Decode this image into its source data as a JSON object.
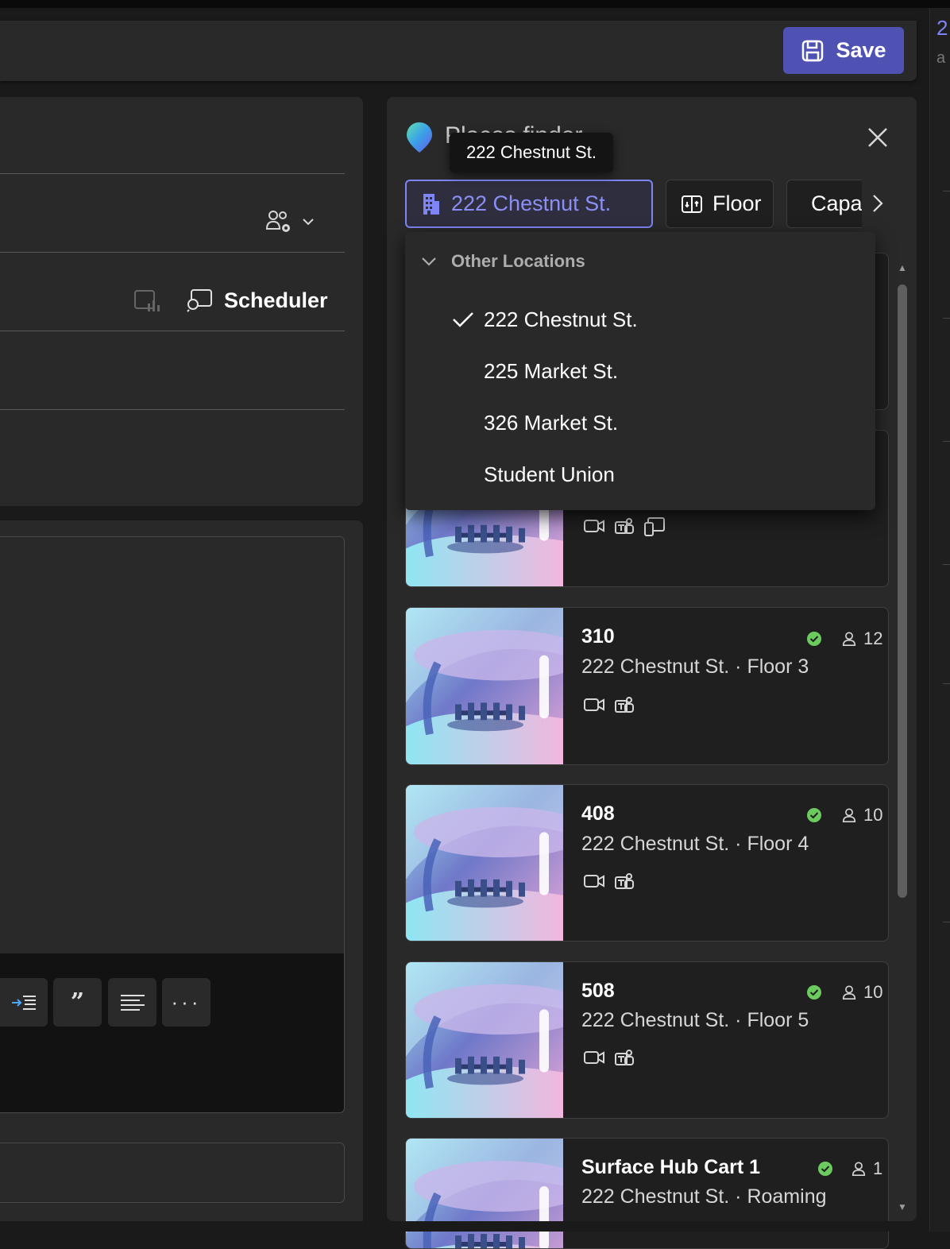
{
  "header": {
    "save_label": "Save"
  },
  "left": {
    "scheduler_label": "Scheduler"
  },
  "panel": {
    "title": "Places finder",
    "tooltip": "222 Chestnut St.",
    "filters": {
      "location": "222 Chestnut St.",
      "floor": "Floor",
      "capacity": "Capacity"
    },
    "dropdown": {
      "header": "Other Locations",
      "items": [
        "222 Chestnut St.",
        "225 Market St.",
        "326 Market St.",
        "Student Union"
      ],
      "selected": "222 Chestnut St."
    },
    "rooms": [
      {
        "name": "310",
        "location": "222 Chestnut St. · Floor 3",
        "capacity": "12",
        "available": true,
        "features": [
          "video-icon",
          "teams-icon"
        ]
      },
      {
        "name": "408",
        "location": "222 Chestnut St. · Floor 4",
        "capacity": "10",
        "available": true,
        "features": [
          "video-icon",
          "teams-icon"
        ]
      },
      {
        "name": "508",
        "location": "222 Chestnut St. · Floor 5",
        "capacity": "10",
        "available": true,
        "features": [
          "video-icon",
          "teams-icon"
        ]
      },
      {
        "name": "Surface Hub Cart 1",
        "location": "222 Chestnut St. · Roaming",
        "capacity": "1",
        "available": true,
        "features": []
      }
    ]
  },
  "colors": {
    "accent": "#7f85f5",
    "save_bg": "#4f52b2",
    "available": "#6ccb5f"
  }
}
